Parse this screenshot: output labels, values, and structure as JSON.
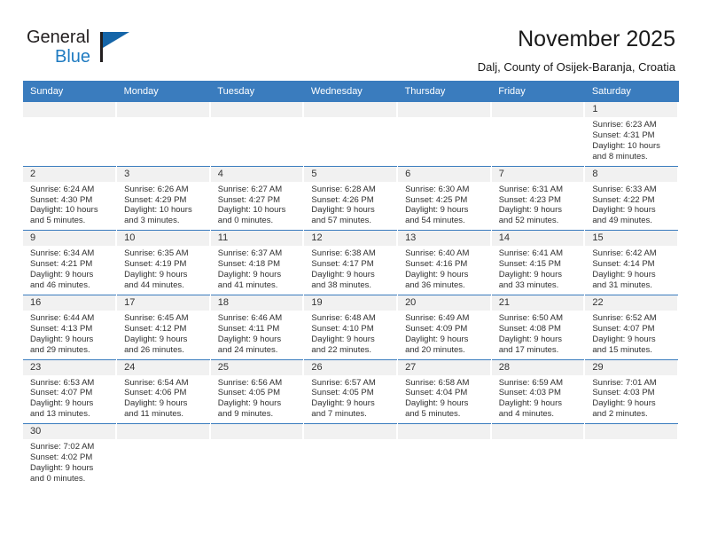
{
  "brand": {
    "name_part1": "General",
    "name_part2": "Blue",
    "accent_color": "#1f7bc1",
    "triangle_color": "#1565a8"
  },
  "header": {
    "title": "November 2025",
    "subtitle": "Dalj, County of Osijek-Baranja, Croatia"
  },
  "calendar": {
    "header_bg": "#3a7cbe",
    "daynum_bg": "#f1f1f1",
    "weekday_headers": [
      "Sunday",
      "Monday",
      "Tuesday",
      "Wednesday",
      "Thursday",
      "Friday",
      "Saturday"
    ],
    "weeks": [
      [
        {
          "day": "",
          "lines": []
        },
        {
          "day": "",
          "lines": []
        },
        {
          "day": "",
          "lines": []
        },
        {
          "day": "",
          "lines": []
        },
        {
          "day": "",
          "lines": []
        },
        {
          "day": "",
          "lines": []
        },
        {
          "day": "1",
          "lines": [
            "Sunrise: 6:23 AM",
            "Sunset: 4:31 PM",
            "Daylight: 10 hours",
            "and 8 minutes."
          ]
        }
      ],
      [
        {
          "day": "2",
          "lines": [
            "Sunrise: 6:24 AM",
            "Sunset: 4:30 PM",
            "Daylight: 10 hours",
            "and 5 minutes."
          ]
        },
        {
          "day": "3",
          "lines": [
            "Sunrise: 6:26 AM",
            "Sunset: 4:29 PM",
            "Daylight: 10 hours",
            "and 3 minutes."
          ]
        },
        {
          "day": "4",
          "lines": [
            "Sunrise: 6:27 AM",
            "Sunset: 4:27 PM",
            "Daylight: 10 hours",
            "and 0 minutes."
          ]
        },
        {
          "day": "5",
          "lines": [
            "Sunrise: 6:28 AM",
            "Sunset: 4:26 PM",
            "Daylight: 9 hours",
            "and 57 minutes."
          ]
        },
        {
          "day": "6",
          "lines": [
            "Sunrise: 6:30 AM",
            "Sunset: 4:25 PM",
            "Daylight: 9 hours",
            "and 54 minutes."
          ]
        },
        {
          "day": "7",
          "lines": [
            "Sunrise: 6:31 AM",
            "Sunset: 4:23 PM",
            "Daylight: 9 hours",
            "and 52 minutes."
          ]
        },
        {
          "day": "8",
          "lines": [
            "Sunrise: 6:33 AM",
            "Sunset: 4:22 PM",
            "Daylight: 9 hours",
            "and 49 minutes."
          ]
        }
      ],
      [
        {
          "day": "9",
          "lines": [
            "Sunrise: 6:34 AM",
            "Sunset: 4:21 PM",
            "Daylight: 9 hours",
            "and 46 minutes."
          ]
        },
        {
          "day": "10",
          "lines": [
            "Sunrise: 6:35 AM",
            "Sunset: 4:19 PM",
            "Daylight: 9 hours",
            "and 44 minutes."
          ]
        },
        {
          "day": "11",
          "lines": [
            "Sunrise: 6:37 AM",
            "Sunset: 4:18 PM",
            "Daylight: 9 hours",
            "and 41 minutes."
          ]
        },
        {
          "day": "12",
          "lines": [
            "Sunrise: 6:38 AM",
            "Sunset: 4:17 PM",
            "Daylight: 9 hours",
            "and 38 minutes."
          ]
        },
        {
          "day": "13",
          "lines": [
            "Sunrise: 6:40 AM",
            "Sunset: 4:16 PM",
            "Daylight: 9 hours",
            "and 36 minutes."
          ]
        },
        {
          "day": "14",
          "lines": [
            "Sunrise: 6:41 AM",
            "Sunset: 4:15 PM",
            "Daylight: 9 hours",
            "and 33 minutes."
          ]
        },
        {
          "day": "15",
          "lines": [
            "Sunrise: 6:42 AM",
            "Sunset: 4:14 PM",
            "Daylight: 9 hours",
            "and 31 minutes."
          ]
        }
      ],
      [
        {
          "day": "16",
          "lines": [
            "Sunrise: 6:44 AM",
            "Sunset: 4:13 PM",
            "Daylight: 9 hours",
            "and 29 minutes."
          ]
        },
        {
          "day": "17",
          "lines": [
            "Sunrise: 6:45 AM",
            "Sunset: 4:12 PM",
            "Daylight: 9 hours",
            "and 26 minutes."
          ]
        },
        {
          "day": "18",
          "lines": [
            "Sunrise: 6:46 AM",
            "Sunset: 4:11 PM",
            "Daylight: 9 hours",
            "and 24 minutes."
          ]
        },
        {
          "day": "19",
          "lines": [
            "Sunrise: 6:48 AM",
            "Sunset: 4:10 PM",
            "Daylight: 9 hours",
            "and 22 minutes."
          ]
        },
        {
          "day": "20",
          "lines": [
            "Sunrise: 6:49 AM",
            "Sunset: 4:09 PM",
            "Daylight: 9 hours",
            "and 20 minutes."
          ]
        },
        {
          "day": "21",
          "lines": [
            "Sunrise: 6:50 AM",
            "Sunset: 4:08 PM",
            "Daylight: 9 hours",
            "and 17 minutes."
          ]
        },
        {
          "day": "22",
          "lines": [
            "Sunrise: 6:52 AM",
            "Sunset: 4:07 PM",
            "Daylight: 9 hours",
            "and 15 minutes."
          ]
        }
      ],
      [
        {
          "day": "23",
          "lines": [
            "Sunrise: 6:53 AM",
            "Sunset: 4:07 PM",
            "Daylight: 9 hours",
            "and 13 minutes."
          ]
        },
        {
          "day": "24",
          "lines": [
            "Sunrise: 6:54 AM",
            "Sunset: 4:06 PM",
            "Daylight: 9 hours",
            "and 11 minutes."
          ]
        },
        {
          "day": "25",
          "lines": [
            "Sunrise: 6:56 AM",
            "Sunset: 4:05 PM",
            "Daylight: 9 hours",
            "and 9 minutes."
          ]
        },
        {
          "day": "26",
          "lines": [
            "Sunrise: 6:57 AM",
            "Sunset: 4:05 PM",
            "Daylight: 9 hours",
            "and 7 minutes."
          ]
        },
        {
          "day": "27",
          "lines": [
            "Sunrise: 6:58 AM",
            "Sunset: 4:04 PM",
            "Daylight: 9 hours",
            "and 5 minutes."
          ]
        },
        {
          "day": "28",
          "lines": [
            "Sunrise: 6:59 AM",
            "Sunset: 4:03 PM",
            "Daylight: 9 hours",
            "and 4 minutes."
          ]
        },
        {
          "day": "29",
          "lines": [
            "Sunrise: 7:01 AM",
            "Sunset: 4:03 PM",
            "Daylight: 9 hours",
            "and 2 minutes."
          ]
        }
      ],
      [
        {
          "day": "30",
          "lines": [
            "Sunrise: 7:02 AM",
            "Sunset: 4:02 PM",
            "Daylight: 9 hours",
            "and 0 minutes."
          ]
        },
        {
          "day": "",
          "lines": []
        },
        {
          "day": "",
          "lines": []
        },
        {
          "day": "",
          "lines": []
        },
        {
          "day": "",
          "lines": []
        },
        {
          "day": "",
          "lines": []
        },
        {
          "day": "",
          "lines": []
        }
      ]
    ]
  }
}
